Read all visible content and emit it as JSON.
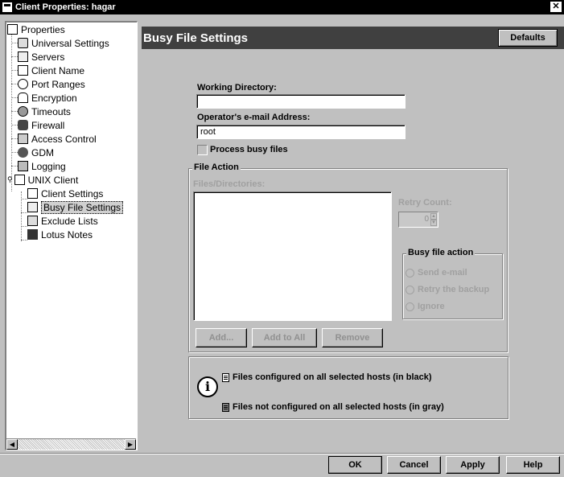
{
  "window": {
    "title": "Client Properties: hagar",
    "close_glyph": "✕"
  },
  "tree": {
    "items": [
      {
        "label": "Properties",
        "icon": "properties-icon"
      },
      {
        "label": "Universal Settings",
        "icon": "universal-settings-icon"
      },
      {
        "label": "Servers",
        "icon": "servers-icon"
      },
      {
        "label": "Client Name",
        "icon": "client-name-icon"
      },
      {
        "label": "Port Ranges",
        "icon": "port-ranges-icon"
      },
      {
        "label": "Encryption",
        "icon": "lock-icon"
      },
      {
        "label": "Timeouts",
        "icon": "timeouts-icon"
      },
      {
        "label": "Firewall",
        "icon": "firewall-icon"
      },
      {
        "label": "Access Control",
        "icon": "access-control-icon"
      },
      {
        "label": "GDM",
        "icon": "gdm-icon"
      },
      {
        "label": "Logging",
        "icon": "logging-icon"
      },
      {
        "label": "UNIX Client",
        "icon": "unix-client-icon"
      },
      {
        "label": "Client Settings",
        "icon": "client-settings-icon"
      },
      {
        "label": "Busy File Settings",
        "icon": "busy-file-icon",
        "selected": true
      },
      {
        "label": "Exclude Lists",
        "icon": "exclude-lists-icon"
      },
      {
        "label": "Lotus Notes",
        "icon": "lotus-notes-icon"
      }
    ]
  },
  "header": {
    "title": "Busy File Settings",
    "defaults_label": "Defaults"
  },
  "form": {
    "working_dir_label": "Working Directory:",
    "working_dir_value": "",
    "email_label": "Operator's e-mail Address:",
    "email_value": "root",
    "process_busy_label": "Process busy files",
    "process_busy_checked": false
  },
  "file_action": {
    "legend": "File Action",
    "files_label": "Files/Directories:",
    "retry_label": "Retry Count:",
    "retry_value": "0",
    "busy_action_legend": "Busy file action",
    "options": [
      "Send e-mail",
      "Retry the backup",
      "Ignore"
    ],
    "add_label": "Add...",
    "add_all_label": "Add to All",
    "remove_label": "Remove"
  },
  "info": {
    "black_text": "Files configured on all selected hosts (in black)",
    "gray_text": "Files not configured on all selected hosts (in gray)"
  },
  "footer": {
    "ok": "OK",
    "cancel": "Cancel",
    "apply": "Apply",
    "help": "Help"
  }
}
